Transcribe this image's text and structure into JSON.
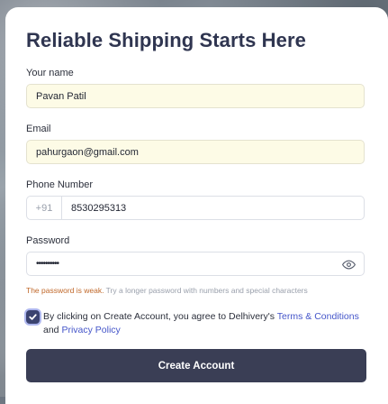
{
  "form": {
    "title": "Reliable Shipping Starts Here",
    "name": {
      "label": "Your name",
      "value": "Pavan Patil"
    },
    "email": {
      "label": "Email",
      "value": "pahurgaon@gmail.com"
    },
    "phone": {
      "label": "Phone Number",
      "prefix": "+91",
      "value": "8530295313"
    },
    "password": {
      "label": "Password",
      "value": "••••••••••",
      "toggle_icon": "eye-icon"
    },
    "strength": {
      "status": "The password is weak.",
      "tip": "Try a longer password with numbers and special characters",
      "status_color": "#c0682a"
    },
    "consent": {
      "checked": true,
      "text_before": "By clicking on Create Account, you agree to Delhivery's",
      "terms_link": "Terms & Conditions",
      "and": "and",
      "privacy_link": "Privacy Policy"
    },
    "submit_label": "Create Account"
  },
  "colors": {
    "primary_button": "#3a3e55",
    "link": "#4455c9",
    "title": "#2f3550",
    "autofill_background": "#fdfbe6"
  }
}
